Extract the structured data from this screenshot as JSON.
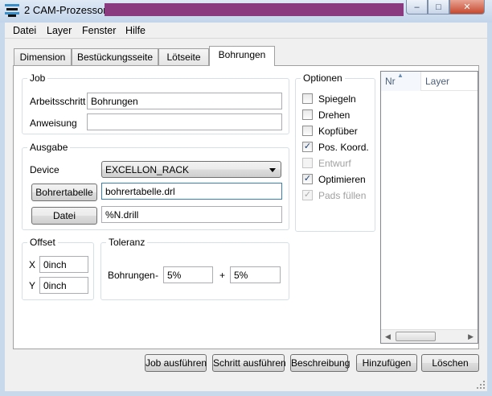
{
  "window": {
    "title": "2 CAM-Prozessor -",
    "minimize_glyph": "–",
    "maximize_glyph": "□",
    "close_glyph": "✕"
  },
  "menu": [
    "Datei",
    "Layer",
    "Fenster",
    "Hilfe"
  ],
  "tabs": [
    {
      "label": "Dimension",
      "active": false
    },
    {
      "label": "Bestückungsseite",
      "active": false
    },
    {
      "label": "Lötseite",
      "active": false
    },
    {
      "label": "Bohrungen",
      "active": true
    }
  ],
  "job": {
    "title": "Job",
    "step_label": "Arbeitsschritt",
    "step_value": "Bohrungen",
    "instruction_label": "Anweisung",
    "instruction_value": ""
  },
  "output": {
    "title": "Ausgabe",
    "device_label": "Device",
    "device_value": "EXCELLON_RACK",
    "drill_table_button": "Bohrertabelle",
    "drill_table_value": "bohrertabelle.drl",
    "file_button": "Datei",
    "file_value": "%N.drill"
  },
  "offset": {
    "title": "Offset",
    "x_label": "X",
    "x_value": "0inch",
    "y_label": "Y",
    "y_value": "0inch"
  },
  "tolerance": {
    "title": "Toleranz",
    "label": "Bohrungen",
    "minus": "-",
    "minus_value": "5%",
    "plus": "+",
    "plus_value": "5%"
  },
  "options": {
    "title": "Optionen",
    "items": [
      {
        "label": "Spiegeln",
        "checked": false,
        "enabled": true,
        "mark": ""
      },
      {
        "label": "Drehen",
        "checked": false,
        "enabled": true,
        "mark": ""
      },
      {
        "label": "Kopfüber",
        "checked": false,
        "enabled": true,
        "mark": ""
      },
      {
        "label": "Pos. Koord.",
        "checked": true,
        "enabled": true,
        "mark": "✓"
      },
      {
        "label": "Entwurf",
        "checked": false,
        "enabled": false,
        "mark": ""
      },
      {
        "label": "Optimieren",
        "checked": true,
        "enabled": true,
        "mark": "✓"
      },
      {
        "label": "Pads füllen",
        "checked": true,
        "enabled": false,
        "mark": "✓"
      }
    ]
  },
  "layer_list": {
    "col_nr": "Nr",
    "col_layer": "Layer"
  },
  "buttons": {
    "run_job": "Job ausführen",
    "run_step": "Schritt ausführen",
    "description": "Beschreibung",
    "add": "Hinzufügen",
    "delete": "Löschen"
  },
  "colors": {
    "title_bar": "#c2d4ea",
    "redaction": "#8a3a7e",
    "close_button": "#c6472c",
    "focus_border": "#3c7fb1"
  }
}
